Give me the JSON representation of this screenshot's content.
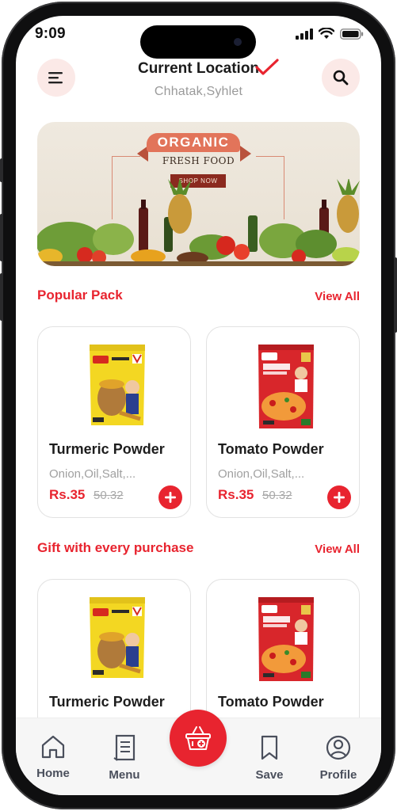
{
  "status_bar": {
    "time": "9:09"
  },
  "header": {
    "location_title": "Current Location",
    "location_subtitle": "Chhatak,Syhlet"
  },
  "banner": {
    "ribbon_text": "ORGANIC",
    "subtitle": "FRESH FOOD",
    "cta": "SHOP NOW"
  },
  "popular": {
    "title": "Popular Pack",
    "view_all": "View All",
    "items": [
      {
        "name": "Turmeric Powder",
        "desc": "Onion,Oil,Salt,...",
        "price": "Rs.35",
        "old_price": "50.32"
      },
      {
        "name": "Tomato Powder",
        "desc": "Onion,Oil,Salt,...",
        "price": "Rs.35",
        "old_price": "50.32"
      }
    ]
  },
  "gift": {
    "title": "Gift with every purchase",
    "view_all": "View All",
    "items": [
      {
        "name": "Turmeric Powder"
      },
      {
        "name": "Tomato Powder"
      }
    ]
  },
  "nav": {
    "home": "Home",
    "menu": "Menu",
    "save": "Save",
    "profile": "Profile"
  },
  "colors": {
    "accent": "#e8242f",
    "accent_soft": "#fbe9e7",
    "text_dark": "#1d1d1d",
    "text_muted": "#a0a0a0"
  },
  "icons": {
    "menu_button": "hamburger-icon",
    "search_button": "search-icon",
    "location_verified": "check-icon",
    "add": "plus-icon",
    "home": "home-icon",
    "menu": "document-icon",
    "cart": "basket-icon",
    "save": "bookmark-icon",
    "profile": "user-icon"
  }
}
